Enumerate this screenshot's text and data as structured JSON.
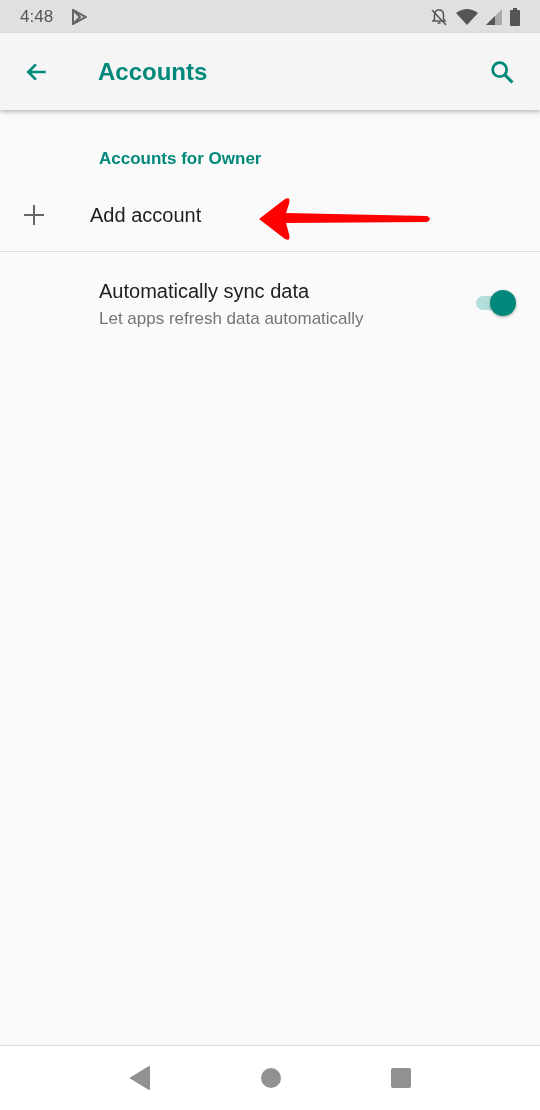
{
  "status_bar": {
    "time": "4:48"
  },
  "app_bar": {
    "title": "Accounts"
  },
  "section": {
    "header": "Accounts for Owner"
  },
  "add_account": {
    "label": "Add account"
  },
  "sync": {
    "title": "Automatically sync data",
    "summary": "Let apps refresh data automatically",
    "on": true
  }
}
